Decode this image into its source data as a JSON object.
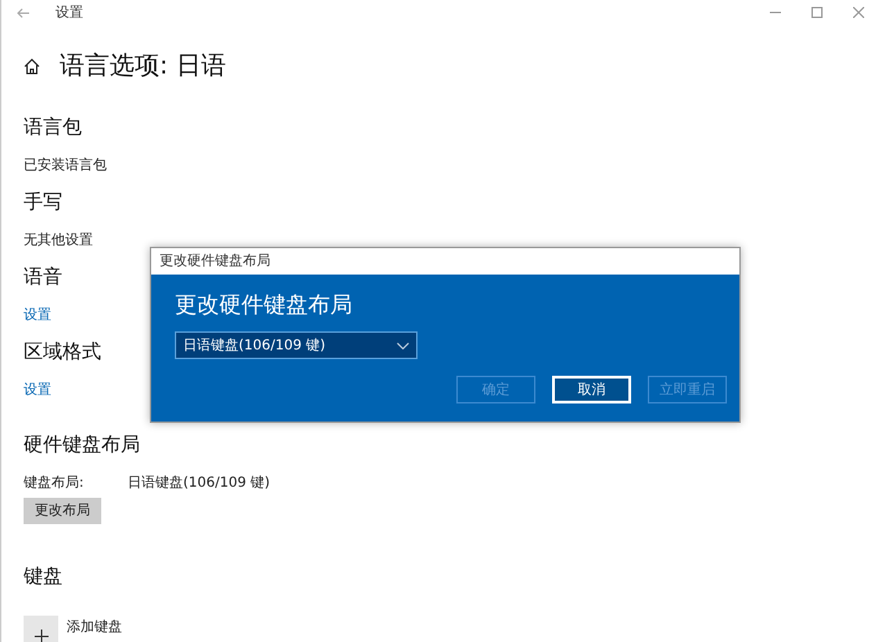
{
  "window": {
    "title": "设置"
  },
  "page": {
    "title": "语言选项: 日语"
  },
  "sections": [
    {
      "heading": "语言包",
      "items": [
        {
          "kind": "text",
          "text": "已安装语言包"
        }
      ]
    },
    {
      "heading": "手写",
      "items": [
        {
          "kind": "text",
          "text": "无其他设置"
        }
      ]
    },
    {
      "heading": "语音",
      "items": [
        {
          "kind": "link",
          "text": "设置"
        }
      ]
    },
    {
      "heading": "区域格式",
      "items": [
        {
          "kind": "link",
          "text": "设置"
        }
      ]
    },
    {
      "heading": "硬件键盘布局",
      "items": [
        {
          "kind": "field",
          "label": "键盘布局:",
          "value": "日语键盘(106/109 键)"
        },
        {
          "kind": "button",
          "text": "更改布局"
        }
      ]
    },
    {
      "heading": "键盘",
      "items": [
        {
          "kind": "add",
          "text": "添加键盘"
        }
      ]
    }
  ],
  "dialog": {
    "title": "更改硬件键盘布局",
    "heading": "更改硬件键盘布局",
    "dropdown": {
      "value": "日语键盘(106/109 键)"
    },
    "buttons": [
      {
        "label": "确定",
        "disabled": true
      },
      {
        "label": "取消",
        "disabled": false
      },
      {
        "label": "立即重启",
        "disabled": true
      }
    ]
  }
}
